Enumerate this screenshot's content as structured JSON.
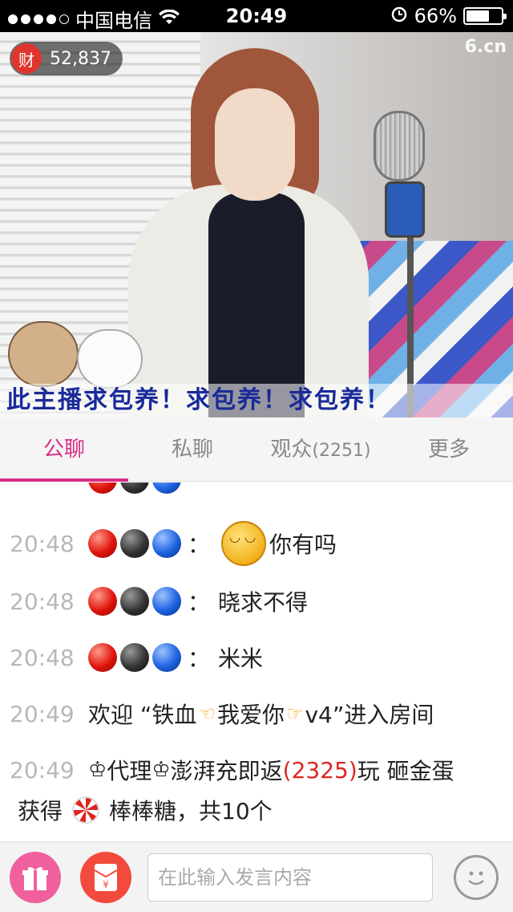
{
  "status_bar": {
    "carrier": "中国电信",
    "time": "20:49",
    "battery_percent": "66%",
    "battery_level": 0.66
  },
  "video": {
    "wealth_badge": "财",
    "wealth_count": "52,837",
    "logo": "6.cn",
    "banner_text": "此主播求包养！求包养！求包养！"
  },
  "tabs": [
    {
      "label": "公聊"
    },
    {
      "label": "私聊"
    },
    {
      "label": "观众",
      "count": "(2251)"
    },
    {
      "label": "更多"
    }
  ],
  "messages": [
    {
      "time": "20:48",
      "text": "你有吗"
    },
    {
      "time": "20:48",
      "text": "晓求不得"
    },
    {
      "time": "20:48",
      "text": "米米"
    },
    {
      "time": "20:49",
      "welcome_prefix": "欢迎 “铁血",
      "welcome_mid": "我爱你",
      "welcome_suffix": "v4”进入房间"
    },
    {
      "time": "20:49",
      "title1": "代理",
      "name": "澎湃充即返",
      "num": "(2325)",
      "action": " 玩 砸金蛋",
      "line2a": "获得",
      "line2b": "棒棒糖，共10个"
    }
  ],
  "message_separator": "：",
  "input": {
    "placeholder": "在此输入发言内容"
  },
  "colors": {
    "accent": "#d92c87",
    "gift": "#f0609e",
    "redpack": "#f24a3c"
  }
}
